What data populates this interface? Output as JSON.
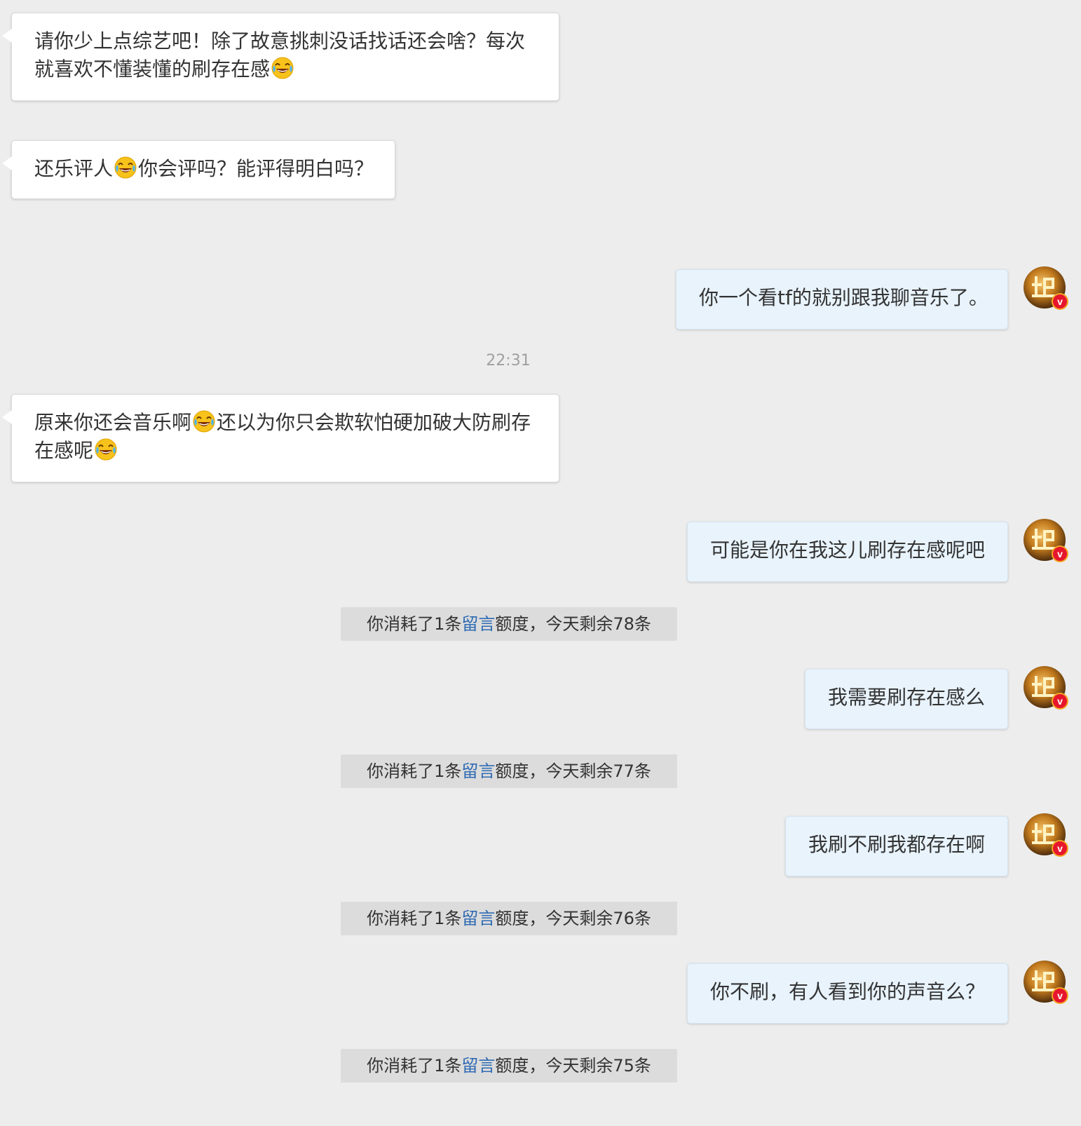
{
  "messages": [
    {
      "side": "in",
      "lines": [
        "请你少上点综艺吧！除了故意挑刺没话找话还会啥？每次",
        "就喜欢不懂装懂的刷存在感😂"
      ]
    },
    {
      "side": "in",
      "lines": [
        "还乐评人😂你会评吗？能评得明白吗？"
      ]
    },
    {
      "side": "out",
      "text": "你一个看tf的就别跟我聊音乐了。"
    },
    {
      "side": "in",
      "lines": [
        "原来你还会音乐啊😂还以为你只会欺软怕硬加破大防刷存",
        "在感呢😂"
      ]
    },
    {
      "side": "out",
      "text": "可能是你在我这儿刷存在感呢吧"
    },
    {
      "side": "out",
      "text": "我需要刷存在感么"
    },
    {
      "side": "out",
      "text": "我刷不刷我都存在啊"
    },
    {
      "side": "out",
      "text": "你不刷，有人看到你的声音么？"
    }
  ],
  "timestamp": "22:31",
  "notices": [
    {
      "prefix": "你消耗了1条",
      "link": "留言",
      "suffix": "额度，今天剩余78条"
    },
    {
      "prefix": "你消耗了1条",
      "link": "留言",
      "suffix": "额度，今天剩余77条"
    },
    {
      "prefix": "你消耗了1条",
      "link": "留言",
      "suffix": "额度，今天剩余76条"
    },
    {
      "prefix": "你消耗了1条",
      "link": "留言",
      "suffix": "额度，今天剩余75条"
    }
  ],
  "avatar": {
    "icon": "user-avatar-icon",
    "badge": "v"
  },
  "colors": {
    "background": "#ededed",
    "incoming_bubble": "#ffffff",
    "outgoing_bubble": "#e8f3fc",
    "link": "#2f6bb3",
    "verify_badge": "#e6162d"
  }
}
